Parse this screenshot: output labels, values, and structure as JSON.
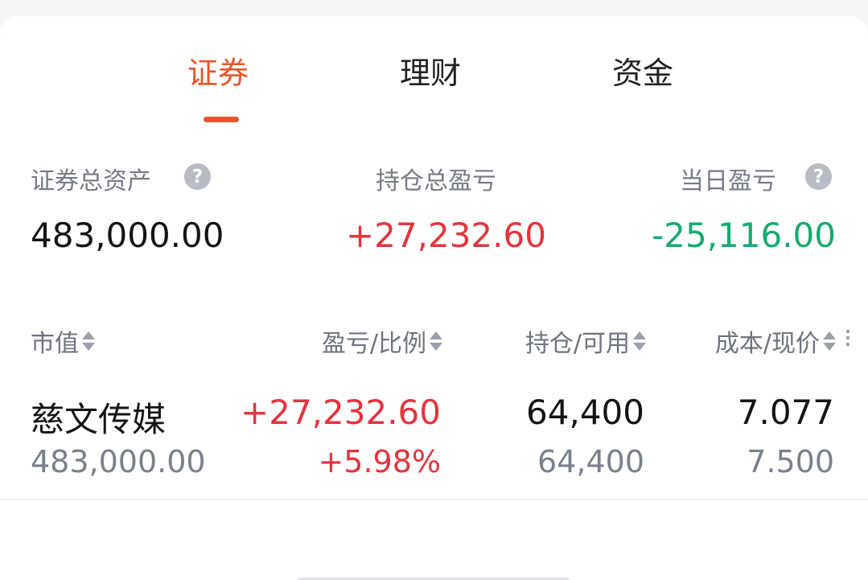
{
  "tabs": [
    {
      "label": "证券",
      "active": true
    },
    {
      "label": "理财",
      "active": false
    },
    {
      "label": "资金",
      "active": false
    }
  ],
  "summary": {
    "total_assets_label": "证券总资产",
    "total_assets_value": "483,000.00",
    "position_pnl_label": "持仓总盈亏",
    "position_pnl_value": "+27,232.60",
    "today_pnl_label": "当日盈亏",
    "today_pnl_value": "-25,116.00"
  },
  "table": {
    "headers": [
      "市值",
      "盈亏/比例",
      "持仓/可用",
      "成本/现价"
    ],
    "rows": [
      {
        "name": "慈文传媒",
        "market_value": "483,000.00",
        "pnl": "+27,232.60",
        "pnl_ratio": "+5.98%",
        "position": "64,400",
        "available": "64,400",
        "cost": "7.077",
        "price": "7.500"
      }
    ]
  },
  "colors": {
    "accent": "#e5572a",
    "up": "#e5333d",
    "down": "#14ab6f"
  },
  "icons": [
    "help-icon",
    "sort-icon",
    "more-columns-icon"
  ]
}
